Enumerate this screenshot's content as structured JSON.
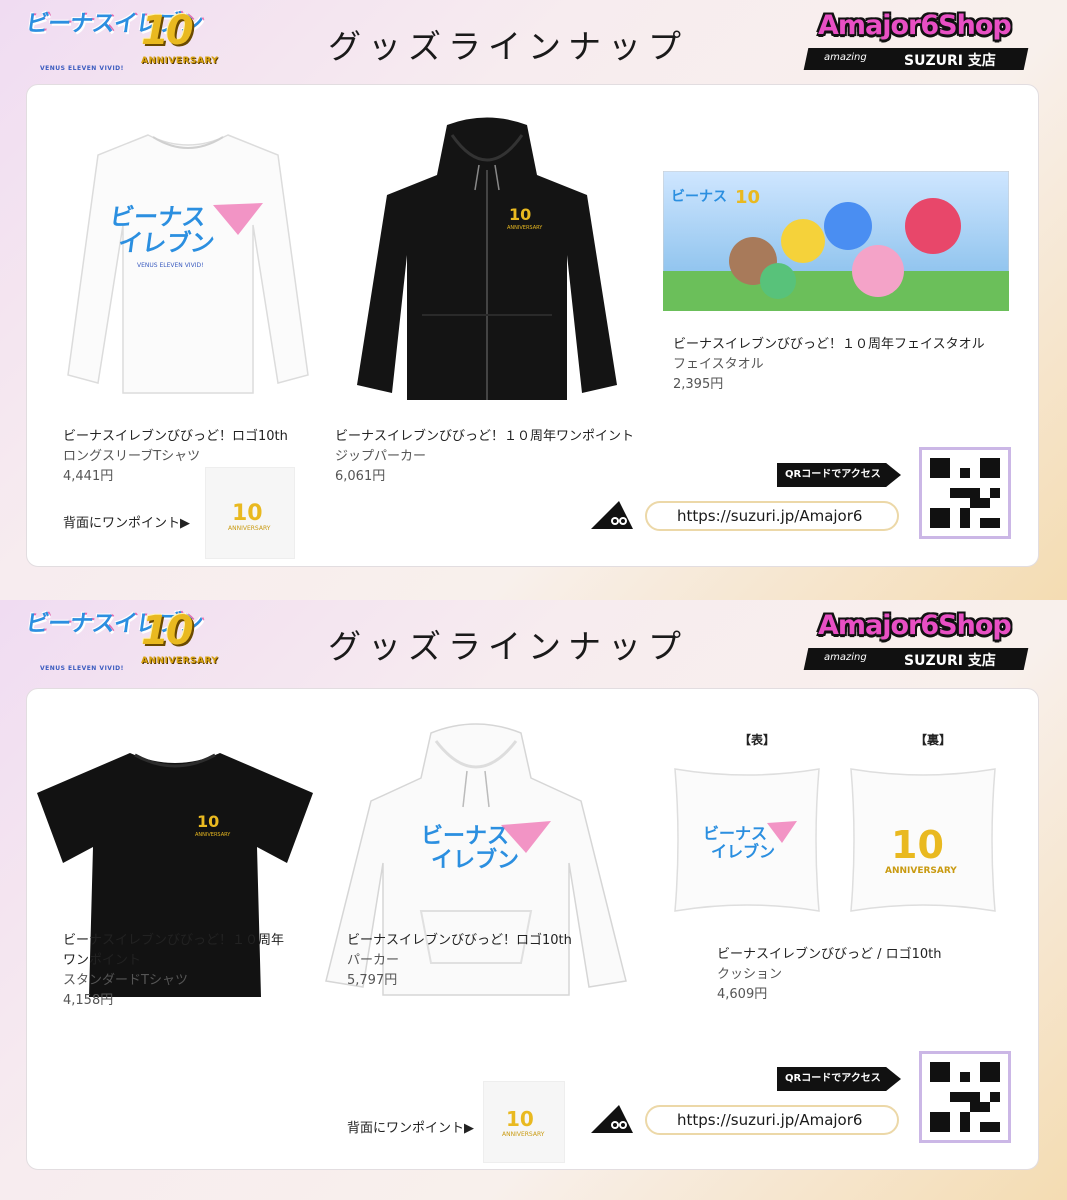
{
  "header": {
    "title": "グッズラインナップ",
    "venus_logo_text": "ビーナスイレブン",
    "venus_logo_sub": "VENUS ELEVEN VIVID!",
    "anniv_number": "10",
    "anniv_text": "ANNIVERSARY",
    "shop_name": "Amajor6Shop",
    "shop_amazing": "amazing",
    "shop_sub": "SUZURI 支店"
  },
  "panels": [
    {
      "products": [
        {
          "name": "ビーナスイレブンびびっど！ロゴ10th",
          "type": "ロングスリーブTシャツ",
          "price": "4,441円"
        },
        {
          "name": "ビーナスイレブンびびっど！１０周年ワンポイント",
          "type": "ジップパーカー",
          "price": "6,061円"
        },
        {
          "name": "ビーナスイレブンびびっど！１０周年フェイスタオル",
          "type": "フェイスタオル",
          "price": "2,395円"
        }
      ],
      "back_label": "背面にワンポイント▶",
      "qr_label": "QRコードでアクセス",
      "url": "https://suzuri.jp/Amajor6"
    },
    {
      "products": [
        {
          "name": "ビーナスイレブンびびっど！１０周年",
          "name2": "ワンポイント",
          "type": "スタンダードTシャツ",
          "price": "4,158円"
        },
        {
          "name": "ビーナスイレブンびびっど！ロゴ10th",
          "type": "パーカー",
          "price": "5,797円"
        },
        {
          "name": "ビーナスイレブンびびっど / ロゴ10th",
          "type": "クッション",
          "price": "4,609円"
        }
      ],
      "cushion_front": "【表】",
      "cushion_back": "【裏】",
      "back_label": "背面にワンポイント▶",
      "qr_label": "QRコードでアクセス",
      "url": "https://suzuri.jp/Amajor6"
    }
  ],
  "colors": {
    "accent_pink": "#e84fc4",
    "accent_blue": "#2b8fe0",
    "gold": "#e9b920"
  }
}
